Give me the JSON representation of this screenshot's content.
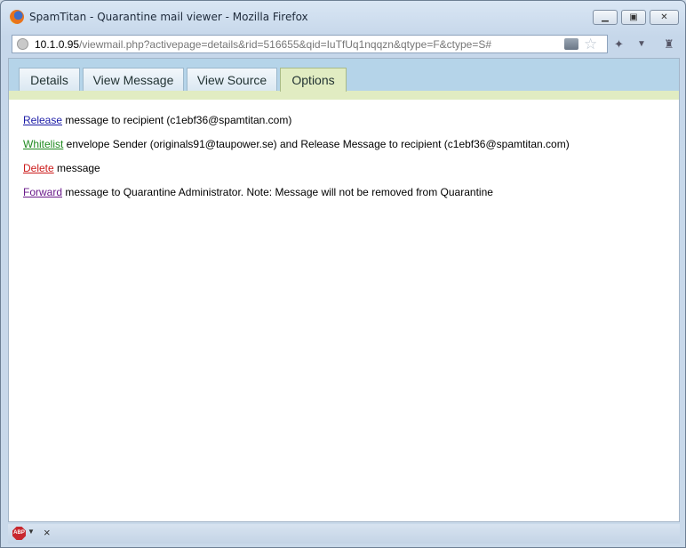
{
  "window": {
    "title": "SpamTitan - Quarantine mail viewer - Mozilla Firefox"
  },
  "address": {
    "host": "10.1.0.95",
    "path": "/viewmail.php?activepage=details&rid=516655&qid=IuTfUq1nqqzn&qtype=F&ctype=S#"
  },
  "tabs": [
    {
      "label": "Details"
    },
    {
      "label": "View Message"
    },
    {
      "label": "View Source"
    },
    {
      "label": "Options"
    }
  ],
  "options": [
    {
      "link": "Release",
      "color": "#1a1aa6",
      "text": " message to recipient (c1ebf36@spamtitan.com)"
    },
    {
      "link": "Whitelist",
      "color": "#1f8a1f",
      "text": " envelope Sender (originals91@taupower.se) and Release Message to recipient (c1ebf36@spamtitan.com)"
    },
    {
      "link": "Delete",
      "color": "#cc1a1a",
      "text": " message"
    },
    {
      "link": "Forward",
      "color": "#6a1a8a",
      "text": " message to Quarantine Administrator. Note: Message will not be removed from Quarantine"
    }
  ],
  "statusbar": {
    "abp_label": "ABP",
    "close_glyph": "×"
  }
}
